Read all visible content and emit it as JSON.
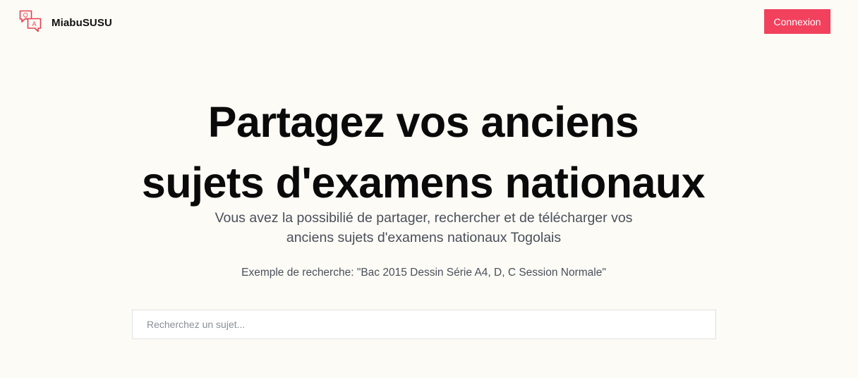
{
  "header": {
    "brand_name": "MiabuSUSU",
    "brand_icon": "qa-chat-bubbles-icon",
    "brand_icon_letters": [
      "Q",
      "A"
    ],
    "login_label": "Connexion"
  },
  "hero": {
    "title_lines": [
      "Partagez vos anciens",
      "sujets d'examens nationaux"
    ],
    "subtitle_lines": [
      "Vous avez la possibilié de partager, rechercher et de télécharger vos",
      "anciens sujets d'examens nationaux Togolais"
    ],
    "example": "Exemple de recherche: \"Bac 2015 Dessin Série A4, D, C Session Normale\""
  },
  "search": {
    "placeholder": "Recherchez un sujet...",
    "value": ""
  },
  "colors": {
    "background": "#fcfbf6",
    "accent": "#f2415d",
    "title": "#0a0a0a",
    "muted_text": "#4a4f59"
  }
}
